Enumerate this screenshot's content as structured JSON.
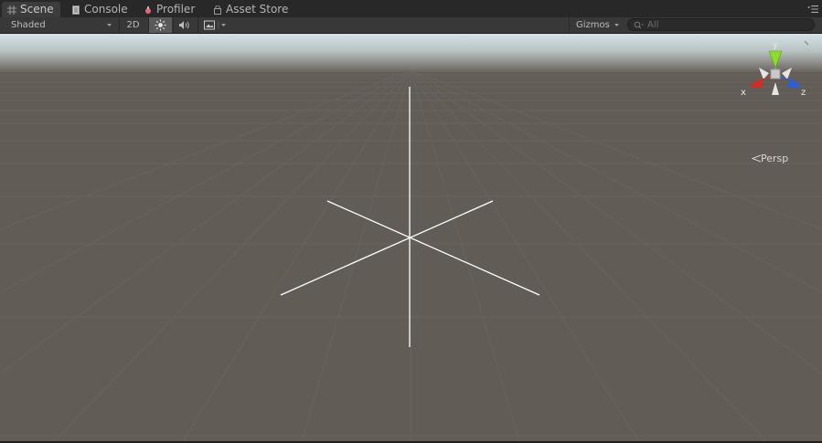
{
  "tabs": [
    {
      "label": "Scene",
      "icon": "grid-icon",
      "active": true
    },
    {
      "label": "Console",
      "icon": "console-icon",
      "active": false
    },
    {
      "label": "Profiler",
      "icon": "profiler-icon",
      "active": false
    },
    {
      "label": "Asset Store",
      "icon": "bag-icon",
      "active": false
    }
  ],
  "toolbar": {
    "shading_mode": "Shaded",
    "mode_2d_label": "2D",
    "lighting_on": true,
    "gizmos_label": "Gizmos",
    "search_placeholder": "All"
  },
  "gizmo": {
    "axis_y": "y",
    "axis_x": "x",
    "axis_z": "z",
    "colors": {
      "y": "#8cdc2a",
      "x": "#d62a22",
      "z": "#2a5ee0"
    }
  },
  "view": {
    "projection_label": "Persp"
  }
}
